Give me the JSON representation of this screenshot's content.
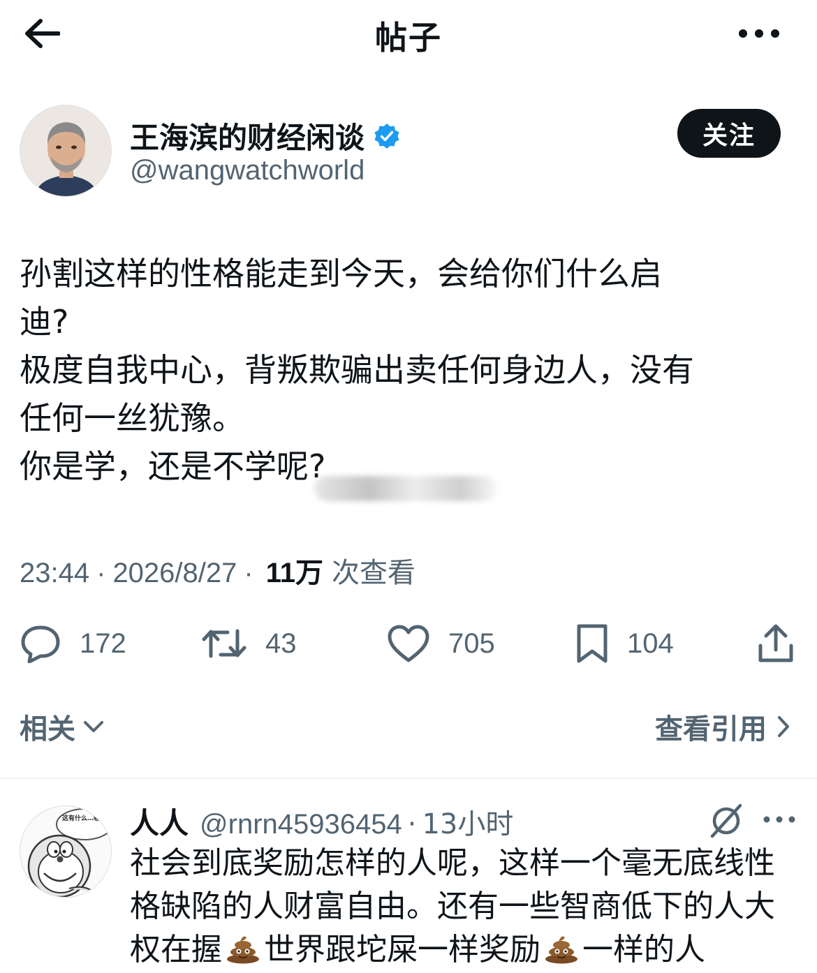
{
  "header": {
    "title": "帖子"
  },
  "author": {
    "name": "王海滨的财经闲谈",
    "handle": "@wangwatchworld",
    "follow_label": "关注"
  },
  "post": {
    "lines": [
      "孙割这样的性格能走到今天，会给你们什么启",
      "迪?",
      "极度自我中心，背叛欺骗出卖任何身边人，没有",
      "任何一丝犹豫。",
      "你是学，还是不学呢?"
    ],
    "time": "23:44",
    "date": "2026/8/27",
    "views_count": "11万",
    "views_label": "次查看"
  },
  "actions": {
    "replies": "172",
    "reposts": "43",
    "likes": "705",
    "bookmarks": "104"
  },
  "related": {
    "related_label": "相关",
    "quotes_label": "查看引用"
  },
  "reply": {
    "name": "人人",
    "handle": "@rnrn45936454",
    "separator": "·",
    "time": "13小时",
    "line1": "社会到底奖励怎样的人呢，这样一个毫无底线性",
    "line2": "格缺陷的人财富自由。还有一些智商低下的人大",
    "line3_a": "权在握",
    "line3_b": "世界跟坨屎一样奖励",
    "line3_c": "一样的人",
    "avatar_text": "这有什么…哪次不是这"
  },
  "colors": {
    "accent": "#1d9bf0",
    "text": "#0f1419",
    "secondary": "#536471"
  },
  "icons": [
    "back-arrow-icon",
    "more-icon",
    "verified-badge-icon",
    "reply-icon",
    "repost-icon",
    "like-icon",
    "bookmark-icon",
    "share-icon",
    "chevron-down-icon",
    "chevron-right-icon",
    "grok-icon",
    "poop-emoji-icon"
  ]
}
